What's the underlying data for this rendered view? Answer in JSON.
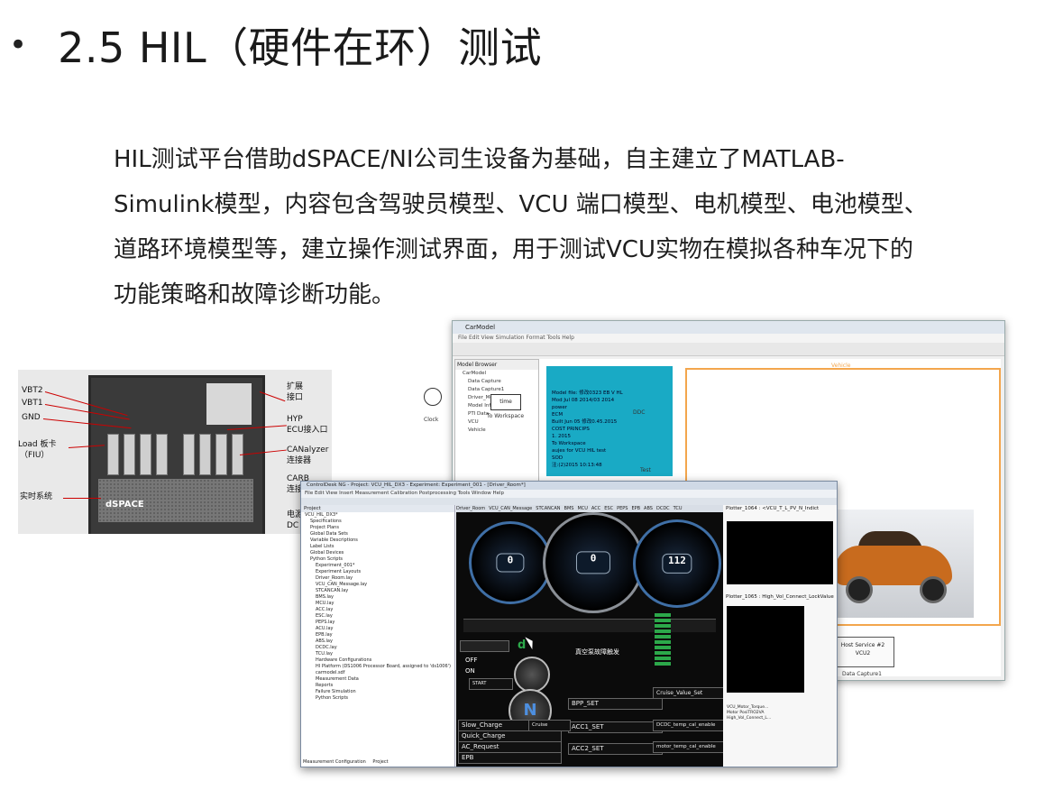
{
  "slide": {
    "bullet": "•",
    "title": "2.5 HIL（硬件在环）测试",
    "paragraph": "HIL测试平台借助dSPACE/NI公司生设备为基础，自主建立了MATLAB-Simulink模型，内容包含驾驶员模型、VCU 端口模型、电机模型、电池模型、道路环境模型等，建立操作测试界面，用于测试VCU实物在模拟各种车况下的功能策略和故障诊断功能。"
  },
  "rack_photo": {
    "labels_left": [
      "VBT2",
      "VBT1",
      "GND",
      "Load 板卡",
      "（FIU）",
      "实时系统"
    ],
    "labels_right": [
      "扩展",
      "接口",
      "HYP",
      "ECU接入口",
      "CANalyzer",
      "连接器",
      "CARB",
      "连接器",
      "电源",
      "DC"
    ],
    "brand": "dSPACE"
  },
  "simulink_window": {
    "title": "CarModel",
    "menu": "File  Edit  View  Simulation  Format  Tools  Help",
    "model_browser_title": "Model Browser",
    "tree": [
      "CarModel",
      "Data Capture",
      "Data Capture1",
      "Driver_Model",
      "Model Info",
      "PTI Data",
      "VCU",
      "Vehicle"
    ],
    "model_info": [
      "Model file: 修改0323 EB V HL",
      "Mod Jul 08 2014/03 2014",
      "power",
      "ECM",
      "Built Jun 05 修改0.45.2015",
      "COST PRINCIPS",
      "1. 2015",
      "To Workspace",
      "aujes for VCU HIL test",
      "SOD",
      "注:(2)2015 10:13:48"
    ],
    "clock_label": "Clock",
    "sink_label": "time",
    "sink_sublabel": "To Workspace",
    "host_service": [
      "Host Service #2",
      "VCU2"
    ],
    "data_capture": "Data Capture1",
    "ddc_label": "DDC",
    "vehicle_label": "Vehicle",
    "test_label": "Test"
  },
  "controldesk_window": {
    "title": "ControlDesk NG - Project: VCU_HIL_DX3 - Experiment: Experiment_001 - [Driver_Room*]",
    "menu": "File  Edit  View  Insert  Measurement  Calibration  Postprocessing  Tools  Window  Help",
    "project_title": "Project",
    "project_tree": [
      "VCU_HIL_DX3*",
      "Specifications",
      "Project Plans",
      "Global Data Sets",
      "Variable Descriptions",
      "Label Lists",
      "Global Devices",
      "Python Scripts",
      "Experiment_001*",
      "Experiment Layouts",
      "Driver_Room.lay",
      "VCU_CAN_Message.lay",
      "STCANCAN.lay",
      "BMS.lay",
      "MCU.lay",
      "ACC.lay",
      "ESC.lay",
      "PEPS.lay",
      "ACU.lay",
      "EPB.lay",
      "ABS.lay",
      "DCDC.lay",
      "TCU.lay",
      "Hardware Configurations",
      "HI Platform (DS1006 Processor Board, assigned to 'ds1006')",
      "carmodel.sdf",
      "Measurement Data",
      "Reports",
      "Failure Simulation",
      "Python Scripts"
    ],
    "bottom_tabs": [
      "Measurement Configuration",
      "Project"
    ],
    "tabs": [
      "Driver_Room",
      "VCU_CAN_Message",
      "STCANCAN",
      "BMS",
      "MCU",
      "ACC",
      "ESC",
      "PEPS",
      "EPB",
      "ABS",
      "DCDC",
      "TCU"
    ],
    "gauge_values": [
      "0",
      "0",
      "112"
    ],
    "gear_indicator": "d",
    "gear_knob": "N",
    "switch_labels": [
      "OFF",
      "ON"
    ],
    "start_label": "START",
    "buttons": [
      "Slow_Charge",
      "Quick_Charge",
      "AC_Request",
      "EPB",
      "BPP_SET",
      "ACC1_SET",
      "ACC2_SET",
      "Cruise",
      "Cruise_Value_Set",
      "DCDC_temp_cal_enable",
      "motor_temp_cal_enable"
    ],
    "fault_title": "真空泵故障触发",
    "plotter_titles": [
      "Plotter_1064 : <VCU_T_L_PV_N_Indict",
      "Plotter_1065 : High_Vol_Connect_LockValue"
    ],
    "legend_items": [
      "VCU_Motor_Torque...",
      "Motor PosiTRO2VA",
      "High_Vol_Connect_L..."
    ]
  }
}
